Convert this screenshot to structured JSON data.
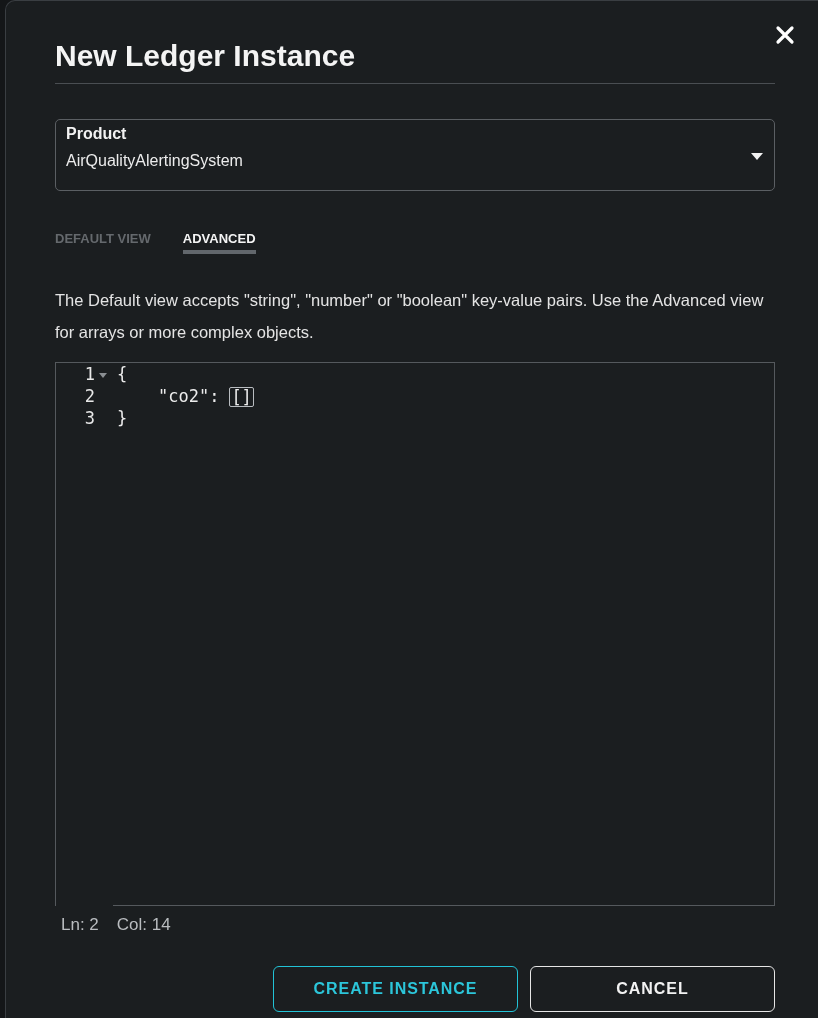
{
  "dialog": {
    "title": "New Ledger Instance"
  },
  "product_field": {
    "label": "Product",
    "value": "AirQualityAlertingSystem"
  },
  "tabs": [
    {
      "label": "DEFAULT VIEW",
      "selected": false
    },
    {
      "label": "ADVANCED",
      "selected": true
    }
  ],
  "description": "The Default view accepts \"string\", \"number\" or \"boolean\" key-value pairs. Use the Advanced view for arrays or more complex objects.",
  "editor": {
    "lines": [
      {
        "number": "1",
        "text": "{",
        "foldable": true
      },
      {
        "number": "2",
        "text": "    \"co2\":",
        "matched_brackets": "[]",
        "foldable": false
      },
      {
        "number": "3",
        "text": "}",
        "foldable": false
      }
    ]
  },
  "status_bar": {
    "line": "Ln: 2",
    "column": "Col: 14"
  },
  "buttons": [
    {
      "label": "CREATE INSTANCE",
      "kind": "primary"
    },
    {
      "label": "CANCEL",
      "kind": "secondary"
    }
  ]
}
